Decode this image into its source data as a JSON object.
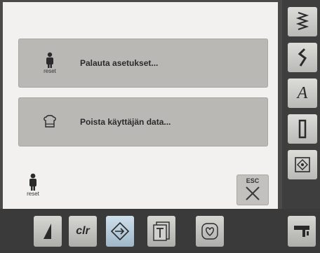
{
  "menu": {
    "reset_button": {
      "label": "Palauta asetukset...",
      "icon_caption": "reset",
      "icon": "person-reset-icon"
    },
    "delete_button": {
      "label": "Poista käyttäjän data...",
      "icon": "chef-hat-icon"
    }
  },
  "footer": {
    "reset_icon_caption": "reset",
    "esc_label": "ESC"
  },
  "sidebar": {
    "items": [
      {
        "icon": "stitch-zigzag-icon"
      },
      {
        "icon": "stitch-s-icon"
      },
      {
        "label": "A",
        "icon": "alphabet-icon"
      },
      {
        "icon": "buttonhole-icon"
      },
      {
        "icon": "quilt-icon"
      },
      {
        "icon": "sewing-machine-icon"
      }
    ]
  },
  "bottom_bar": {
    "items": [
      {
        "icon": "needle-icon"
      },
      {
        "label": "clr",
        "icon": "clear-icon"
      },
      {
        "icon": "setup-arrow-icon",
        "active": true
      },
      {
        "icon": "tutorial-icon"
      },
      {
        "icon": "heart-icon"
      }
    ]
  },
  "colors": {
    "panel": "#f2f1ef",
    "button": "#b9b8b5",
    "frame": "#3a3a3a",
    "active": "#9fb7c9"
  }
}
